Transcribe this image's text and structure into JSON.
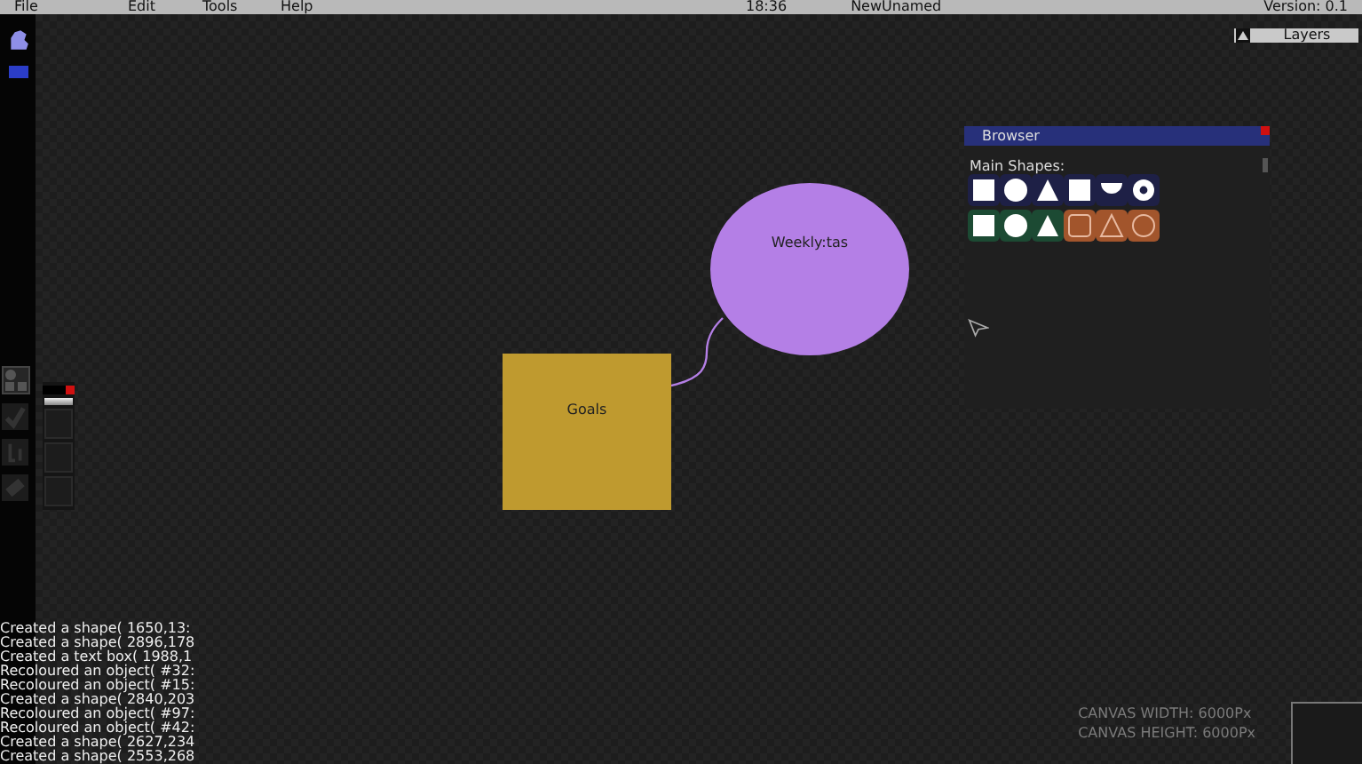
{
  "menu_bar": {
    "items": [
      "File",
      "Edit",
      "Tools",
      "Help"
    ],
    "time": "18:36",
    "document": "NewUnamed",
    "version": "Version: 0.1"
  },
  "layers_button": {
    "label": "Layers"
  },
  "browser": {
    "title": "Browser",
    "section": "Main Shapes:",
    "shapes": [
      {
        "kind": "square",
        "color": "#1e2046"
      },
      {
        "kind": "circle",
        "color": "#1e2046"
      },
      {
        "kind": "triangle",
        "color": "#1e2046"
      },
      {
        "kind": "square",
        "color": "#1e2046"
      },
      {
        "kind": "half-circle",
        "color": "#1e2046"
      },
      {
        "kind": "ring",
        "color": "#1e2046"
      },
      {
        "kind": "square",
        "color": "#1c4a33"
      },
      {
        "kind": "circle",
        "color": "#1c4a33"
      },
      {
        "kind": "triangle",
        "color": "#1c4a33"
      },
      {
        "kind": "square-outline",
        "color": "#a2552c"
      },
      {
        "kind": "triangle-outline",
        "color": "#a2552c"
      },
      {
        "kind": "circle-outline",
        "color": "#a2552c"
      }
    ]
  },
  "nodes": [
    {
      "kind": "square",
      "label": "Goals",
      "color": "#bf9a2f"
    },
    {
      "kind": "ellipse",
      "label": "Weekly:tas",
      "color": "#b47fe6"
    }
  ],
  "log": [
    "Created a shape( 1650,13:",
    "Created a shape( 2896,178",
    "Created a text box( 1988,1",
    "Recoloured an object( #32:",
    "Recoloured an object( #15:",
    "Created a shape( 2840,203",
    "Recoloured an object( #97:",
    "Recoloured an object( #42:",
    "Created a shape( 2627,234",
    "Created a shape( 2553,268"
  ],
  "canvas_info": [
    "CANVAS WIDTH: 6000Px",
    "CANVAS HEIGHT: 6000Px"
  ]
}
